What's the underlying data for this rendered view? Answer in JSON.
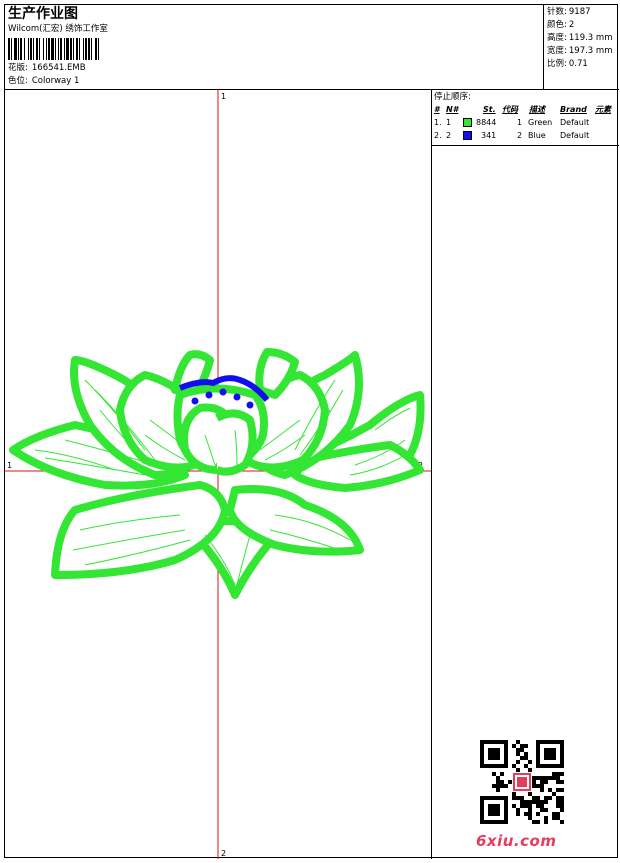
{
  "header": {
    "title": "生产作业图",
    "subtitle": "Wilcom(汇宏) 绣饰工作室",
    "design_label": "花版:",
    "design_value": "166541.EMB",
    "colorway_label": "色位:",
    "colorway_value": "Colorway 1"
  },
  "stats": [
    {
      "label": "针数:",
      "value": "9187"
    },
    {
      "label": "颜色:",
      "value": "2"
    },
    {
      "label": "高度:",
      "value": "119.3 mm"
    },
    {
      "label": "宽度:",
      "value": "197.3 mm"
    },
    {
      "label": "比例:",
      "value": "0.71"
    }
  ],
  "stop_sequence": {
    "title": "停止顺序:",
    "headers": [
      "#",
      "N#",
      "St.",
      "代码",
      "描述",
      "Brand",
      "元素"
    ],
    "rows": [
      {
        "num": "1.",
        "n": "1",
        "color": "#33e633",
        "stitches": "8844",
        "code": "1",
        "desc": "Green",
        "brand": "Default"
      },
      {
        "num": "2.",
        "n": "2",
        "color": "#1010ee",
        "stitches": "341",
        "code": "2",
        "desc": "Blue",
        "brand": "Default"
      }
    ]
  },
  "axis_labels": {
    "top": "1",
    "left": "1",
    "right": "2",
    "bottom": "2"
  },
  "colors": {
    "thread_green": "#33e633",
    "thread_blue": "#1010ee",
    "axis_red": "#e01010",
    "watermark": "#e63c5c"
  },
  "watermark": "6xiu.com",
  "icons": {
    "qr": "qr-code-icon",
    "seal": "red-seal-icon"
  }
}
